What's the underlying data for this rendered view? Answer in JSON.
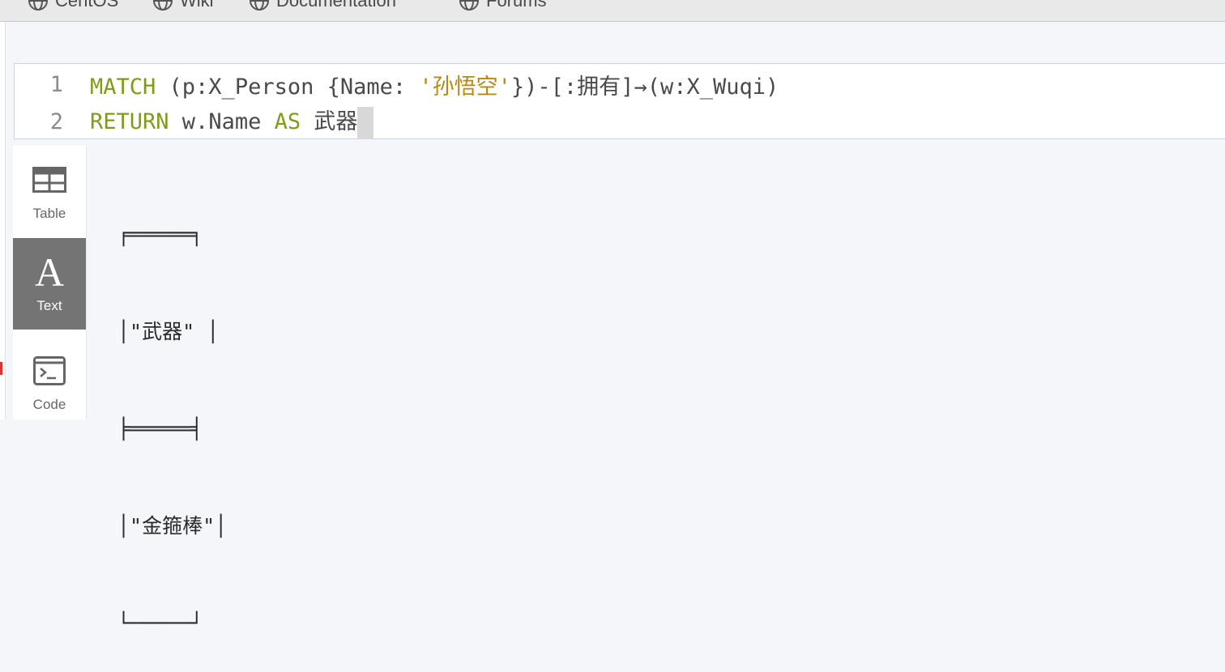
{
  "bookmarks": [
    {
      "label": "CentOS",
      "icon": "globe-icon"
    },
    {
      "label": "Wiki",
      "icon": "globe-icon"
    },
    {
      "label": "Documentation",
      "icon": "globe-icon"
    },
    {
      "label": "Forums",
      "icon": "globe-icon"
    }
  ],
  "editor": {
    "line_numbers": [
      "1",
      "2"
    ],
    "line1": {
      "kw_match": "MATCH",
      "pattern_start": " (p:X_Person {Name: ",
      "name_value": "'孙悟空'",
      "pattern_end": "})-[:拥有]→(w:X_Wuqi)"
    },
    "line2": {
      "kw_return": "RETURN",
      "expr": " w.Name ",
      "kw_as": "AS",
      "alias": " 武器"
    }
  },
  "result_tabs": [
    {
      "label": "Table",
      "icon": "table-icon",
      "active": false
    },
    {
      "label": "Text",
      "icon": "text-icon",
      "active": true
    },
    {
      "label": "Code",
      "icon": "code-icon",
      "active": false
    }
  ],
  "result_text": {
    "top_border": "╒═════╕",
    "header_row": "│\"武器\" │",
    "separator": "╞═════╡",
    "data_row": "│\"金箍棒\"│",
    "bottom_border": "└─────┘"
  },
  "colors": {
    "keyword": "#7e9c1a",
    "string": "#b58a10",
    "active_tab": "#747474"
  }
}
